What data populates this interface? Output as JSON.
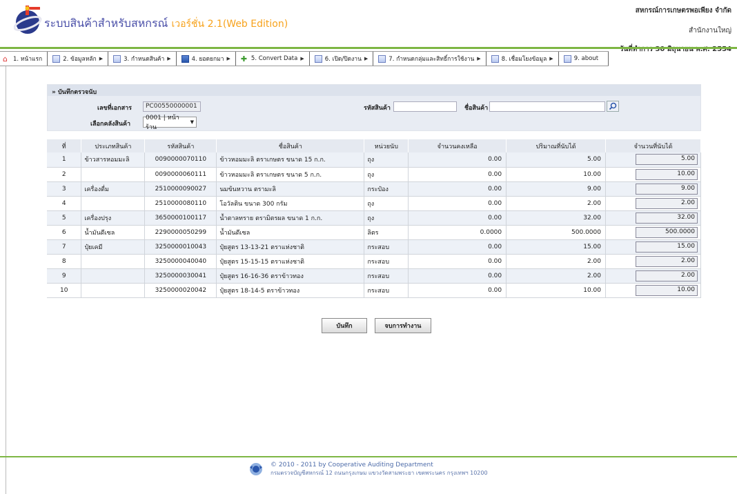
{
  "header": {
    "title": "ระบบสินค้าสำหรับสหกรณ์",
    "version": "เวอร์ชั่น 2.1(Web Edition)",
    "org_name": "สหกรณ์การเกษตรพอเพียง จำกัด",
    "branch": "สำนักงานใหญ่",
    "work_date": "วันที่ทำการ 30 มิถุนายน พ.ศ. 2554"
  },
  "menu": [
    {
      "label": "1. หน้าแรก",
      "icon": "home-icon"
    },
    {
      "label": "2. ข้อมูลหลัก",
      "icon": "checklist-icon"
    },
    {
      "label": "3. กำหนดสินค้า",
      "icon": "checklist-icon"
    },
    {
      "label": "4. ยอดยกมา",
      "icon": "calendar-icon"
    },
    {
      "label": "5. Convert Data",
      "icon": "convert-icon"
    },
    {
      "label": "6. เปิด/ปิดงาน",
      "icon": "checklist-icon"
    },
    {
      "label": "7. กำหนดกลุ่มและสิทธิ์การใช้งาน",
      "icon": "checklist-icon"
    },
    {
      "label": "8. เชื่อมโยงข้อมูล",
      "icon": "checklist-icon"
    },
    {
      "label": "9. about",
      "icon": "checklist-icon"
    }
  ],
  "form": {
    "section_title": "» บันทึกตรวจนับ",
    "doc_no_label": "เลขที่เอกสาร",
    "doc_no_value": "PC00550000001",
    "warehouse_label": "เลือกคลังสินค้า",
    "warehouse_value": "0001 | หน้าร้าน",
    "product_code_label": "รหัสสินค้า",
    "product_code_value": "",
    "product_name_label": "ชื่อสินค้า",
    "product_name_value": ""
  },
  "table": {
    "headers": [
      "ที่",
      "ประเภทสินค้า",
      "รหัสสินค้า",
      "ชื่อสินค้า",
      "หน่วยนับ",
      "จำนวนคงเหลือ",
      "ปริมาณที่นับได้",
      "จำนวนที่นับได้"
    ],
    "rows": [
      {
        "no": "1",
        "type": "ข้าวสารหอมมะลิ",
        "code": "0090000070110",
        "name": "ข้าวหอมมะลิ ตราเกษตร ขนาด 15 ก.ก.",
        "unit": "ถุง",
        "balance": "0.00",
        "counted_qty": "5.00",
        "counted_input": "5.00"
      },
      {
        "no": "2",
        "type": "",
        "code": "0090000060111",
        "name": "ข้าวหอมมะลิ ตราเกษตร ขนาด 5 ก.ก.",
        "unit": "ถุง",
        "balance": "0.00",
        "counted_qty": "10.00",
        "counted_input": "10.00"
      },
      {
        "no": "3",
        "type": "เครื่องดื่ม",
        "code": "2510000090027",
        "name": "นมข้นหวาน ตรามะลิ",
        "unit": "กระป๋อง",
        "balance": "0.00",
        "counted_qty": "9.00",
        "counted_input": "9.00"
      },
      {
        "no": "4",
        "type": "",
        "code": "2510000080110",
        "name": "โอวัลติน ขนาด 300 กรัม",
        "unit": "ถุง",
        "balance": "0.00",
        "counted_qty": "2.00",
        "counted_input": "2.00"
      },
      {
        "no": "5",
        "type": "เครื่องปรุง",
        "code": "3650000100117",
        "name": "น้ำตาลทราย ตรามิตรผล ขนาด 1 ก.ก.",
        "unit": "ถุง",
        "balance": "0.00",
        "counted_qty": "32.00",
        "counted_input": "32.00"
      },
      {
        "no": "6",
        "type": "น้ำมันดีเซล",
        "code": "2290000050299",
        "name": "น้ำมันดีเซล",
        "unit": "ลิตร",
        "balance": "0.0000",
        "counted_qty": "500.0000",
        "counted_input": "500.0000"
      },
      {
        "no": "7",
        "type": "ปุ๋ยเคมี",
        "code": "3250000010043",
        "name": "ปุ๋ยสูตร 13-13-21 ตราแห่งชาติ",
        "unit": "กระสอบ",
        "balance": "0.00",
        "counted_qty": "15.00",
        "counted_input": "15.00"
      },
      {
        "no": "8",
        "type": "",
        "code": "3250000040040",
        "name": "ปุ๋ยสูตร 15-15-15 ตราแห่งชาติ",
        "unit": "กระสอบ",
        "balance": "0.00",
        "counted_qty": "2.00",
        "counted_input": "2.00"
      },
      {
        "no": "9",
        "type": "",
        "code": "3250000030041",
        "name": "ปุ๋ยสูตร 16-16-36 ตราข้าวทอง",
        "unit": "กระสอบ",
        "balance": "0.00",
        "counted_qty": "2.00",
        "counted_input": "2.00"
      },
      {
        "no": "10",
        "type": "",
        "code": "3250000020042",
        "name": "ปุ๋ยสูตร 18-14-5 ตราข้าวทอง",
        "unit": "กระสอบ",
        "balance": "0.00",
        "counted_qty": "10.00",
        "counted_input": "10.00"
      }
    ]
  },
  "buttons": {
    "save": "บันทึก",
    "finish": "จบการทำงาน"
  },
  "footer": {
    "copyright": "© 2010 - 2011  by Cooperative Auditing Department",
    "address": "กรมตรวจบัญชีสหกรณ์ 12 ถนนกรุงเกษม แขวงวัดสามพระยา เขตพระนคร กรุงเทพฯ 10200"
  },
  "colors": {
    "accent_green": "#7db643",
    "title_blue": "#4a4fa8",
    "version_orange": "#f7a21b"
  }
}
